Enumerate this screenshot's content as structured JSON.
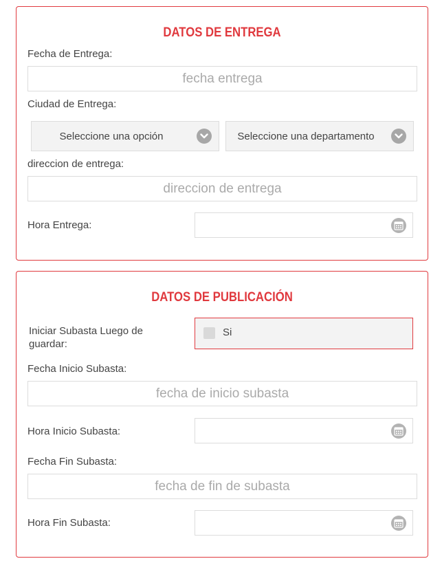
{
  "entrega": {
    "title": "DATOS DE ENTREGA",
    "fecha_label": "Fecha de Entrega:",
    "fecha_placeholder": "fecha entrega",
    "ciudad_label": "Ciudad de Entrega:",
    "ciudad_select": "Seleccione una opción",
    "departamento_select": "Seleccione una departamento",
    "direccion_label": "direccion de entrega:",
    "direccion_placeholder": "direccion de entrega",
    "hora_label": "Hora Entrega:"
  },
  "publicacion": {
    "title": "DATOS DE PUBLICACIÓN",
    "iniciar_label": "Iniciar Subasta Luego de guardar:",
    "iniciar_option": "Si",
    "fecha_inicio_label": "Fecha Inicio Subasta:",
    "fecha_inicio_placeholder": "fecha de inicio subasta",
    "hora_inicio_label": "Hora Inicio Subasta:",
    "fecha_fin_label": "Fecha Fin Subasta:",
    "fecha_fin_placeholder": "fecha de fin de subasta",
    "hora_fin_label": "Hora Fin Subasta:"
  },
  "colors": {
    "accent": "#e0393e",
    "border": "#dcdcdc",
    "field_bg": "#f3f3f3",
    "icon": "#a7a7a7"
  },
  "icons": {
    "select": "chevron-down-icon",
    "time": "calendar-icon"
  }
}
